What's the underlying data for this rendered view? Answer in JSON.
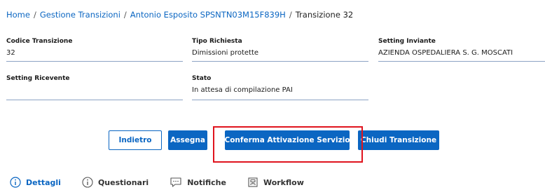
{
  "breadcrumb": {
    "home": "Home",
    "gestione": "Gestione Transizioni",
    "patient": "Antonio Esposito SPSNTN03M15F839H",
    "current": "Transizione 32",
    "separator": "/"
  },
  "fields": {
    "codice": {
      "label": "Codice Transizione",
      "value": "32"
    },
    "tipo": {
      "label": "Tipo Richiesta",
      "value": "Dimissioni protette"
    },
    "inviante": {
      "label": "Setting Inviante",
      "value": "AZIENDA OSPEDALIERA S. G. MOSCATI"
    },
    "ricevente": {
      "label": "Setting Ricevente",
      "value": ""
    },
    "stato": {
      "label": "Stato",
      "value": "In attesa di compilazione PAI"
    }
  },
  "actions": {
    "indietro": "Indietro",
    "assegna": "Assegna",
    "conferma": "Conferma Attivazione Servizio",
    "chiudi": "Chiudi Transizione"
  },
  "tabs": {
    "dettagli": "Dettagli",
    "questionari": "Questionari",
    "notifiche": "Notifiche",
    "workflow": "Workflow"
  },
  "colors": {
    "primary": "#0b66c2",
    "highlight": "#e0141e",
    "field_underline": "#8da3c4"
  },
  "icons": {
    "dettagli": "info-circle-icon",
    "questionari": "info-circle-icon",
    "notifiche": "chat-bubble-icon",
    "workflow": "workflow-icon"
  }
}
